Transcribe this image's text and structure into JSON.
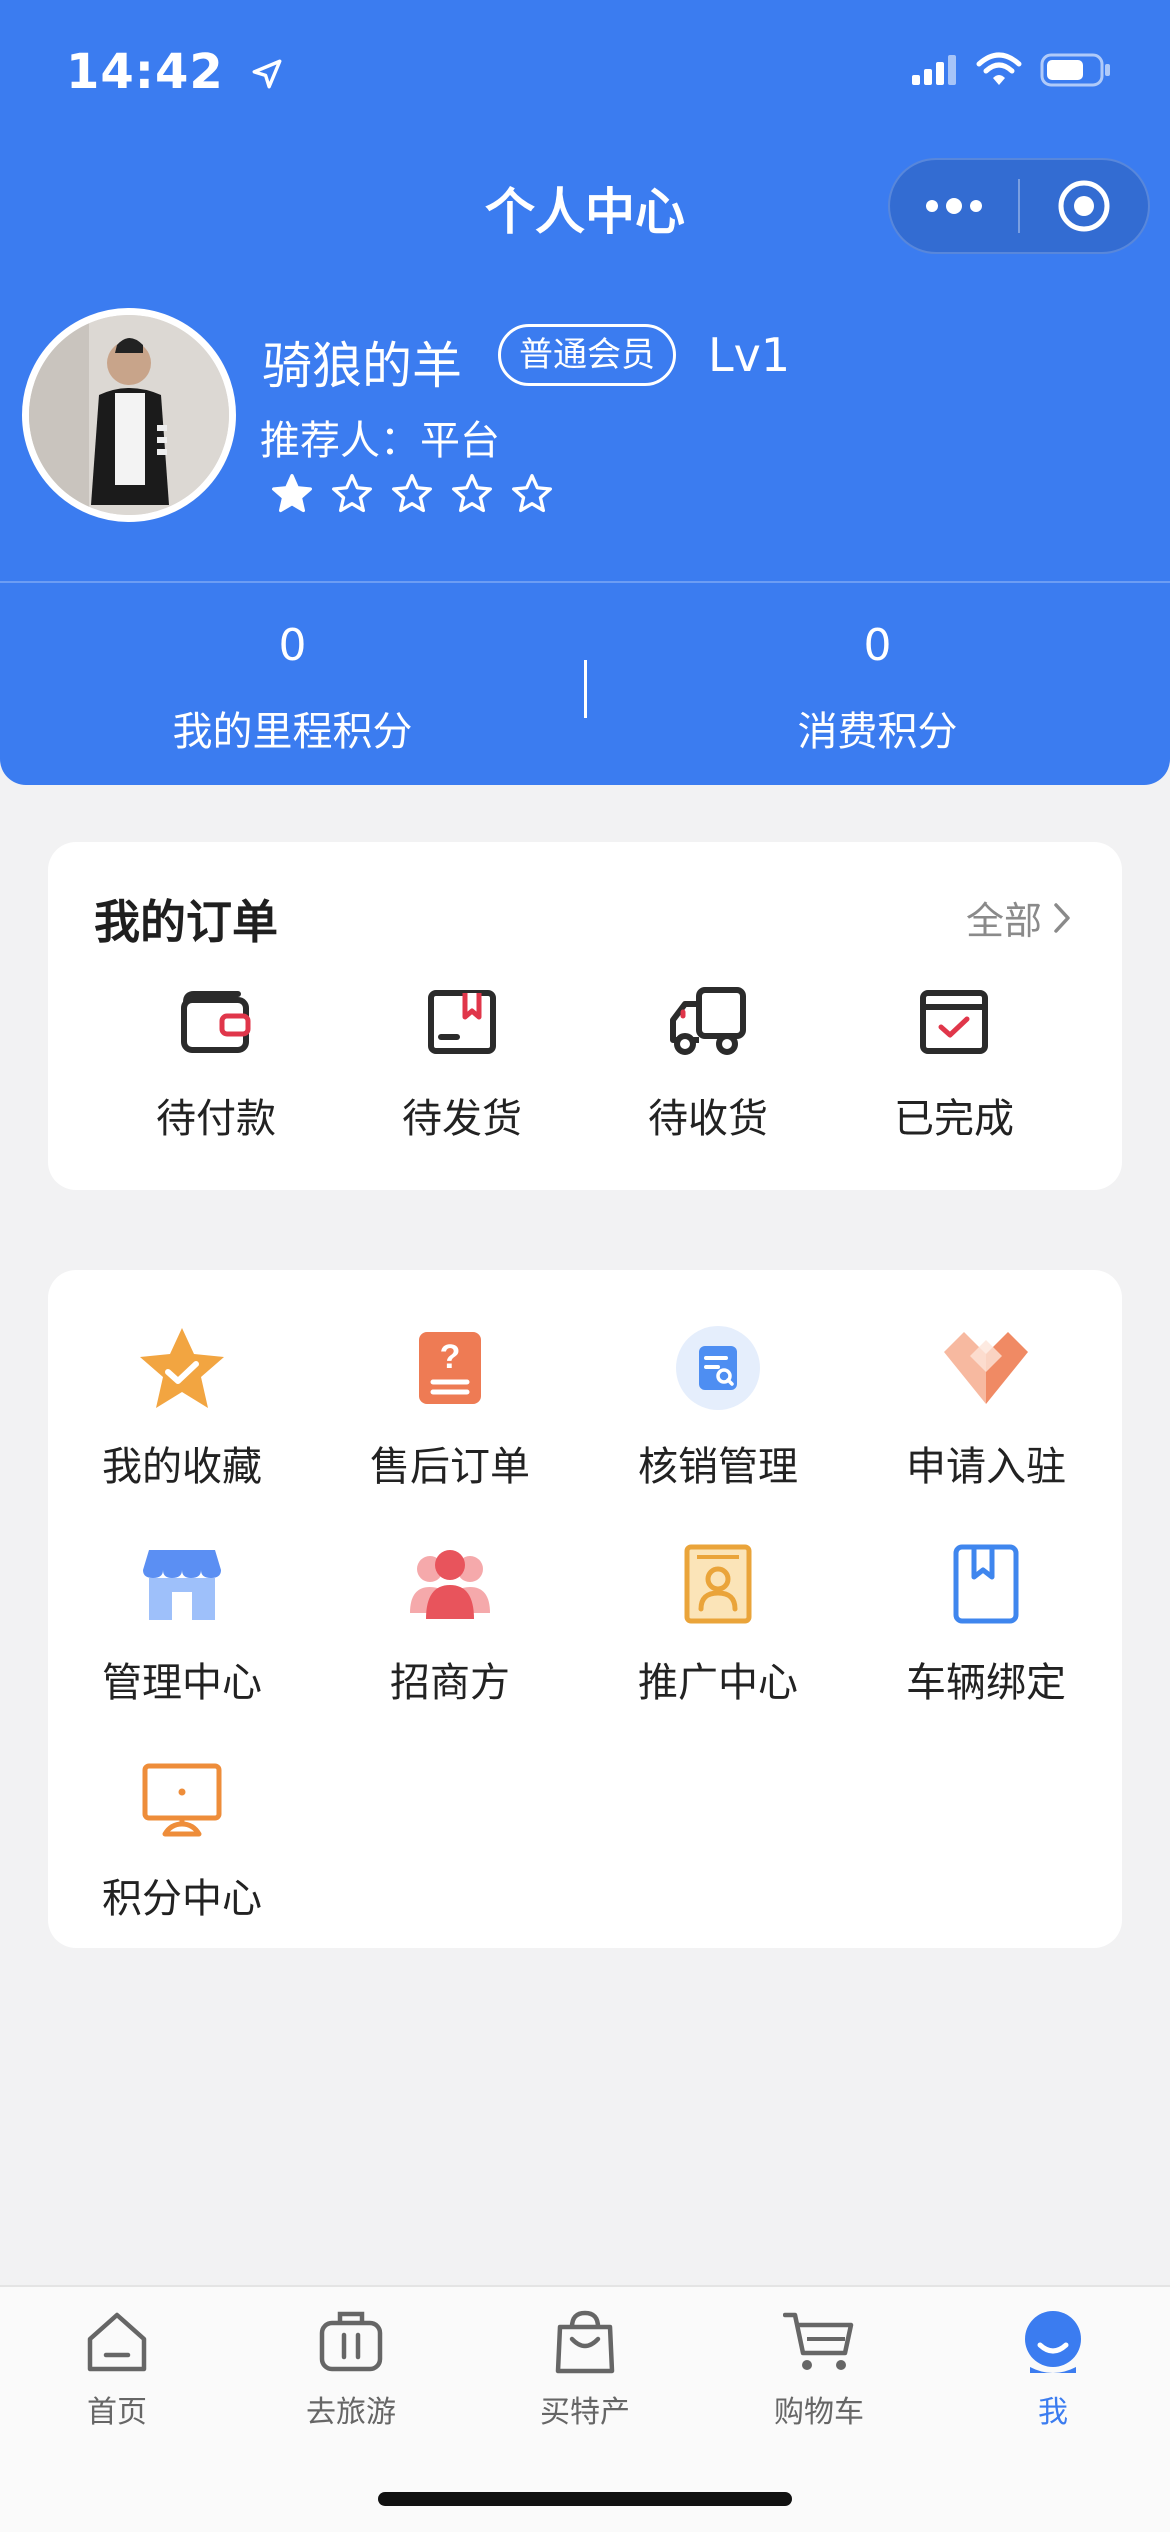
{
  "status_bar": {
    "time": "14:42"
  },
  "header": {
    "title": "个人中心",
    "user": {
      "name": "骑狼的羊",
      "member_badge": "普通会员",
      "level": "Lv1",
      "referrer_label": "推荐人：",
      "referrer_value": "平台",
      "rating": 1,
      "rating_max": 5
    },
    "stats": [
      {
        "value": "0",
        "label": "我的里程积分"
      },
      {
        "value": "0",
        "label": "消费积分"
      }
    ]
  },
  "orders": {
    "title": "我的订单",
    "all_label": "全部",
    "items": [
      {
        "label": "待付款",
        "icon": "wallet-icon"
      },
      {
        "label": "待发货",
        "icon": "package-icon"
      },
      {
        "label": "待收货",
        "icon": "truck-icon"
      },
      {
        "label": "已完成",
        "icon": "completed-box-icon"
      }
    ]
  },
  "tools": [
    {
      "label": "我的收藏",
      "icon": "star-check-icon"
    },
    {
      "label": "售后订单",
      "icon": "question-document-icon"
    },
    {
      "label": "核销管理",
      "icon": "search-document-icon"
    },
    {
      "label": "申请入驻",
      "icon": "heart-apply-icon"
    },
    {
      "label": "管理中心",
      "icon": "store-icon"
    },
    {
      "label": "招商方",
      "icon": "people-icon"
    },
    {
      "label": "推广中心",
      "icon": "contact-card-icon"
    },
    {
      "label": "车辆绑定",
      "icon": "bookmark-icon"
    },
    {
      "label": "积分中心",
      "icon": "monitor-icon"
    }
  ],
  "tabbar": [
    {
      "label": "首页",
      "icon": "home-icon",
      "active": false
    },
    {
      "label": "去旅游",
      "icon": "luggage-icon",
      "active": false
    },
    {
      "label": "买特产",
      "icon": "shopping-bag-icon",
      "active": false
    },
    {
      "label": "购物车",
      "icon": "cart-icon",
      "active": false
    },
    {
      "label": "我",
      "icon": "profile-icon",
      "active": true
    }
  ],
  "colors": {
    "primary": "#3b7cf0",
    "background": "#f2f2f3"
  }
}
